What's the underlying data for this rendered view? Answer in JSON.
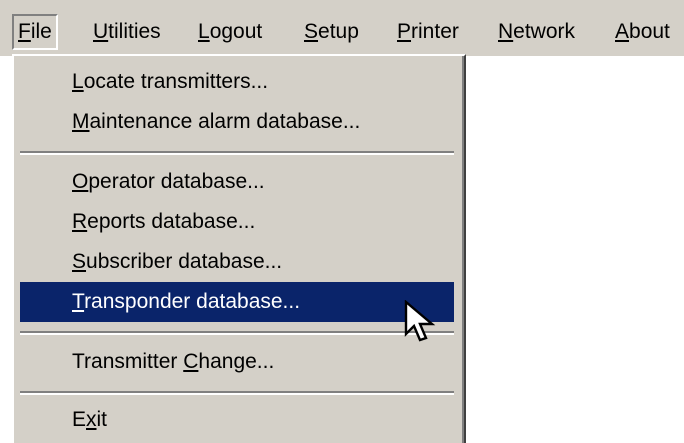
{
  "menubar": {
    "items": [
      {
        "pre": "",
        "key": "F",
        "post": "ile",
        "state": "open"
      },
      {
        "pre": "",
        "key": "U",
        "post": "tilities"
      },
      {
        "pre": "",
        "key": "L",
        "post": "ogout"
      },
      {
        "pre": "",
        "key": "S",
        "post": "etup"
      },
      {
        "pre": "",
        "key": "P",
        "post": "rinter"
      },
      {
        "pre": "",
        "key": "N",
        "post": "etwork"
      },
      {
        "pre": "",
        "key": "A",
        "post": "bout"
      }
    ]
  },
  "file_menu": {
    "items": [
      {
        "pre": "",
        "key": "L",
        "post": "ocate transmitters..."
      },
      {
        "pre": "",
        "key": "M",
        "post": "aintenance alarm database..."
      },
      {
        "pre": "",
        "key": "O",
        "post": "perator database..."
      },
      {
        "pre": "",
        "key": "R",
        "post": "eports database..."
      },
      {
        "pre": "",
        "key": "S",
        "post": "ubscriber database..."
      },
      {
        "pre": "",
        "key": "T",
        "post": "ransponder database...",
        "state": "highlighted"
      },
      {
        "pre": "Transmitter ",
        "key": "C",
        "post": "hange..."
      },
      {
        "pre": "E",
        "key": "x",
        "post": "it"
      }
    ]
  },
  "colors": {
    "menu_face": "#d4d0c8",
    "highlight": "#0a246a",
    "highlight_text": "#ffffff"
  },
  "icons": {
    "cursor": "arrow-pointer-icon"
  }
}
